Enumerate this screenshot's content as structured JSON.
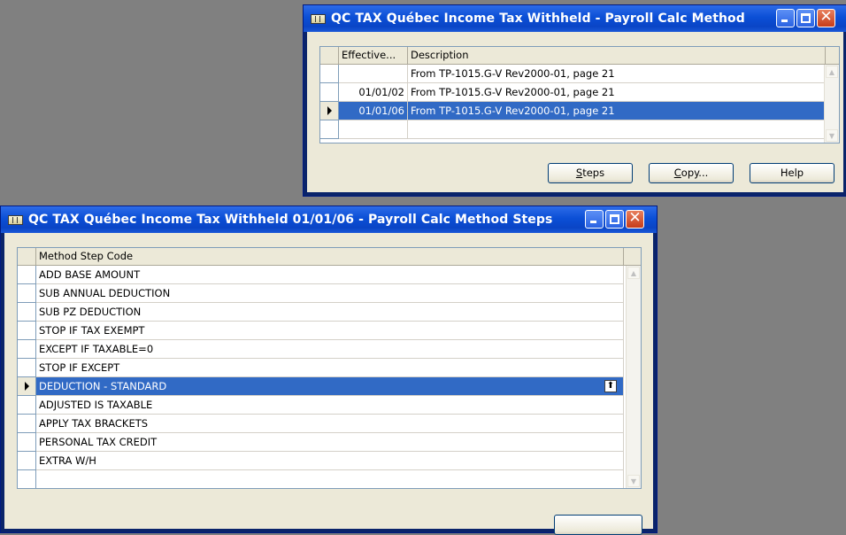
{
  "window_methods": {
    "title": "QC TAX Québec Income Tax Withheld - Payroll Calc Method",
    "columns": [
      "Effective...",
      "Description"
    ],
    "rows": [
      {
        "effective": "",
        "description": "From TP-1015.G-V Rev2000-01, page 21"
      },
      {
        "effective": "01/01/02",
        "description": "From TP-1015.G-V Rev2000-01, page 21"
      },
      {
        "effective": "01/01/06",
        "description": "From TP-1015.G-V Rev2000-01, page 21"
      },
      {
        "effective": "",
        "description": ""
      }
    ],
    "selected_row": 2,
    "buttons": {
      "steps_u": "S",
      "steps_rest": "teps",
      "copy_u": "C",
      "copy_rest": "opy...",
      "help": "Help"
    }
  },
  "window_steps": {
    "title": "QC TAX Québec Income Tax Withheld 01/01/06 - Payroll Calc Method Steps",
    "column": "Method Step Code",
    "rows": [
      "ADD BASE AMOUNT",
      "SUB ANNUAL DEDUCTION",
      "SUB PZ DEDUCTION",
      "STOP IF TAX EXEMPT",
      "EXCEPT IF TAXABLE=0",
      "STOP IF EXCEPT",
      "DEDUCTION - STANDARD",
      "ADJUSTED IS TAXABLE",
      "APPLY TAX BRACKETS",
      "PERSONAL TAX CREDIT",
      "EXTRA W/H",
      ""
    ],
    "selected_row": 6
  }
}
